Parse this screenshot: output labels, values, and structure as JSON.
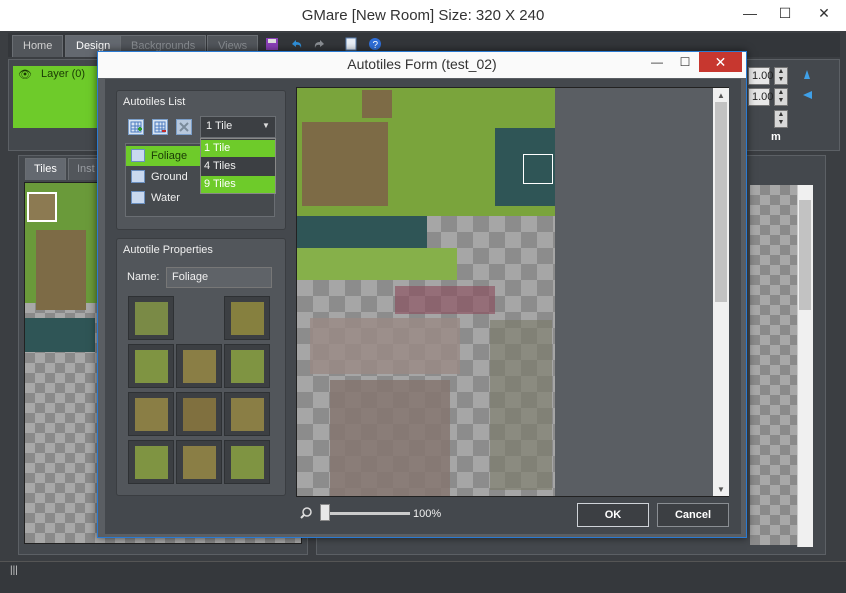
{
  "window": {
    "title": "GMare [New Room] Size: 320 X 240",
    "min": "—",
    "max": "☐",
    "close": "✕"
  },
  "main_tabs": [
    {
      "label": "Home"
    },
    {
      "label": "Design"
    },
    {
      "label": "Backgrounds"
    },
    {
      "label": "Views"
    }
  ],
  "toolbar_icons": [
    "save-icon",
    "undo-icon",
    "redo-icon",
    "notes-icon",
    "help-icon"
  ],
  "layers": {
    "item_label": "Layer (0)"
  },
  "room_props": {
    "values": [
      "1.00",
      "1.00"
    ],
    "partial_label": "m"
  },
  "left_tabs": {
    "tiles": "Tiles",
    "instances": "Inst"
  },
  "dialog": {
    "title": "Autotiles Form (test_02)",
    "min": "—",
    "max": "☐",
    "close": "✕",
    "list_group": {
      "title": "Autotiles List",
      "tiles_select": "1 Tile",
      "items": [
        {
          "label": "Foliage"
        },
        {
          "label": "Ground"
        },
        {
          "label": "Water"
        }
      ],
      "dropdown_options": [
        {
          "label": "1 Tile"
        },
        {
          "label": "4 Tiles"
        },
        {
          "label": "9 Tiles"
        }
      ]
    },
    "props_group": {
      "title": "Autotile Properties",
      "name_label": "Name:",
      "name_value": "Foliage"
    },
    "zoom_label": "100%",
    "ok_label": "OK",
    "cancel_label": "Cancel"
  },
  "colors": {
    "accent_green": "#6ecb2a",
    "panel": "#44484d",
    "close_red": "#c7372f",
    "border_blue": "#2a7ad2"
  }
}
